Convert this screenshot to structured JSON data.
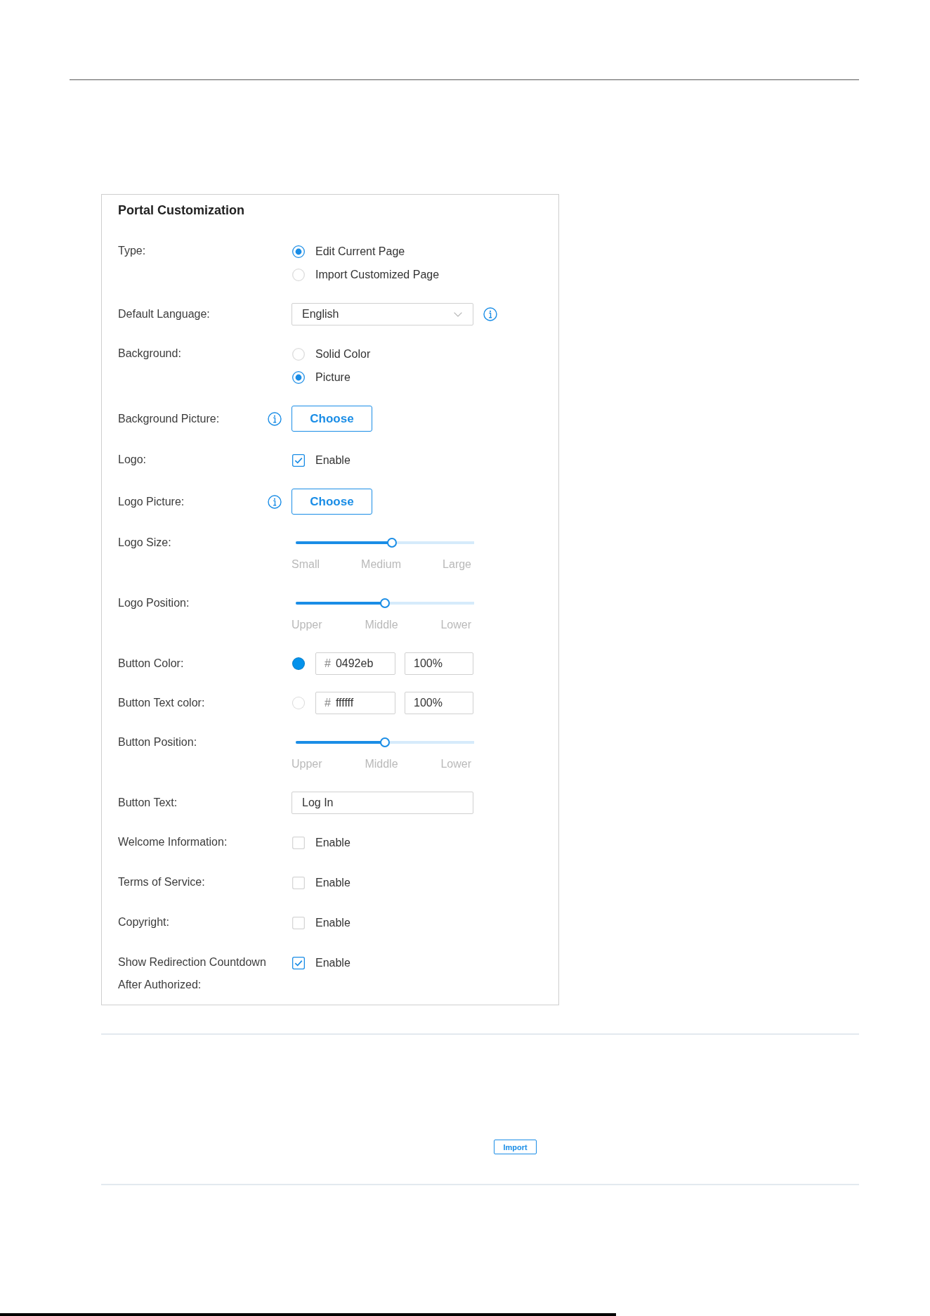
{
  "panel": {
    "title": "Portal Customization",
    "fields": [
      {
        "kind": "radio",
        "label": "Type:",
        "options": [
          {
            "label": "Edit Current Page",
            "selected": true
          },
          {
            "label": "Import Customized Page",
            "selected": false
          }
        ]
      },
      {
        "kind": "select",
        "label": "Default Language:",
        "value": "English",
        "info": true
      },
      {
        "kind": "radio",
        "label": "Background:",
        "options": [
          {
            "label": "Solid Color",
            "selected": false
          },
          {
            "label": "Picture",
            "selected": true
          }
        ]
      },
      {
        "kind": "file",
        "label": "Background Picture:",
        "button": "Choose",
        "info": true
      },
      {
        "kind": "checkbox",
        "label": "Logo:",
        "option": "Enable",
        "checked": true
      },
      {
        "kind": "file",
        "label": "Logo Picture:",
        "button": "Choose",
        "info": true
      },
      {
        "kind": "slider",
        "label": "Logo Size:",
        "level": 0.54,
        "ticks": [
          "Small",
          "Medium",
          "Large"
        ]
      },
      {
        "kind": "slider",
        "label": "Logo Position:",
        "level": 0.5,
        "ticks": [
          "Upper",
          "Middle",
          "Lower"
        ]
      },
      {
        "kind": "color",
        "label": "Button Color:",
        "color": "#0492eb",
        "prefix": "#",
        "hex": "0492eb",
        "opacity": "100%"
      },
      {
        "kind": "color",
        "label": "Button Text color:",
        "color": "#ffffff",
        "prefix": "#",
        "hex": "ffffff",
        "opacity": "100%"
      },
      {
        "kind": "slider",
        "label": "Button Position:",
        "level": 0.5,
        "ticks": [
          "Upper",
          "Middle",
          "Lower"
        ]
      },
      {
        "kind": "text",
        "label": "Button Text:",
        "value": "Log In"
      },
      {
        "kind": "checkbox",
        "label": "Welcome Information:",
        "option": "Enable",
        "checked": false
      },
      {
        "kind": "checkbox",
        "label": "Terms of Service:",
        "option": "Enable",
        "checked": false
      },
      {
        "kind": "checkbox",
        "label": "Copyright:",
        "option": "Enable",
        "checked": false
      },
      {
        "kind": "checkbox",
        "label": "Show Redirection Countdown After Authorized:",
        "option": "Enable",
        "checked": true
      }
    ]
  },
  "import_button": {
    "label": "Import"
  }
}
